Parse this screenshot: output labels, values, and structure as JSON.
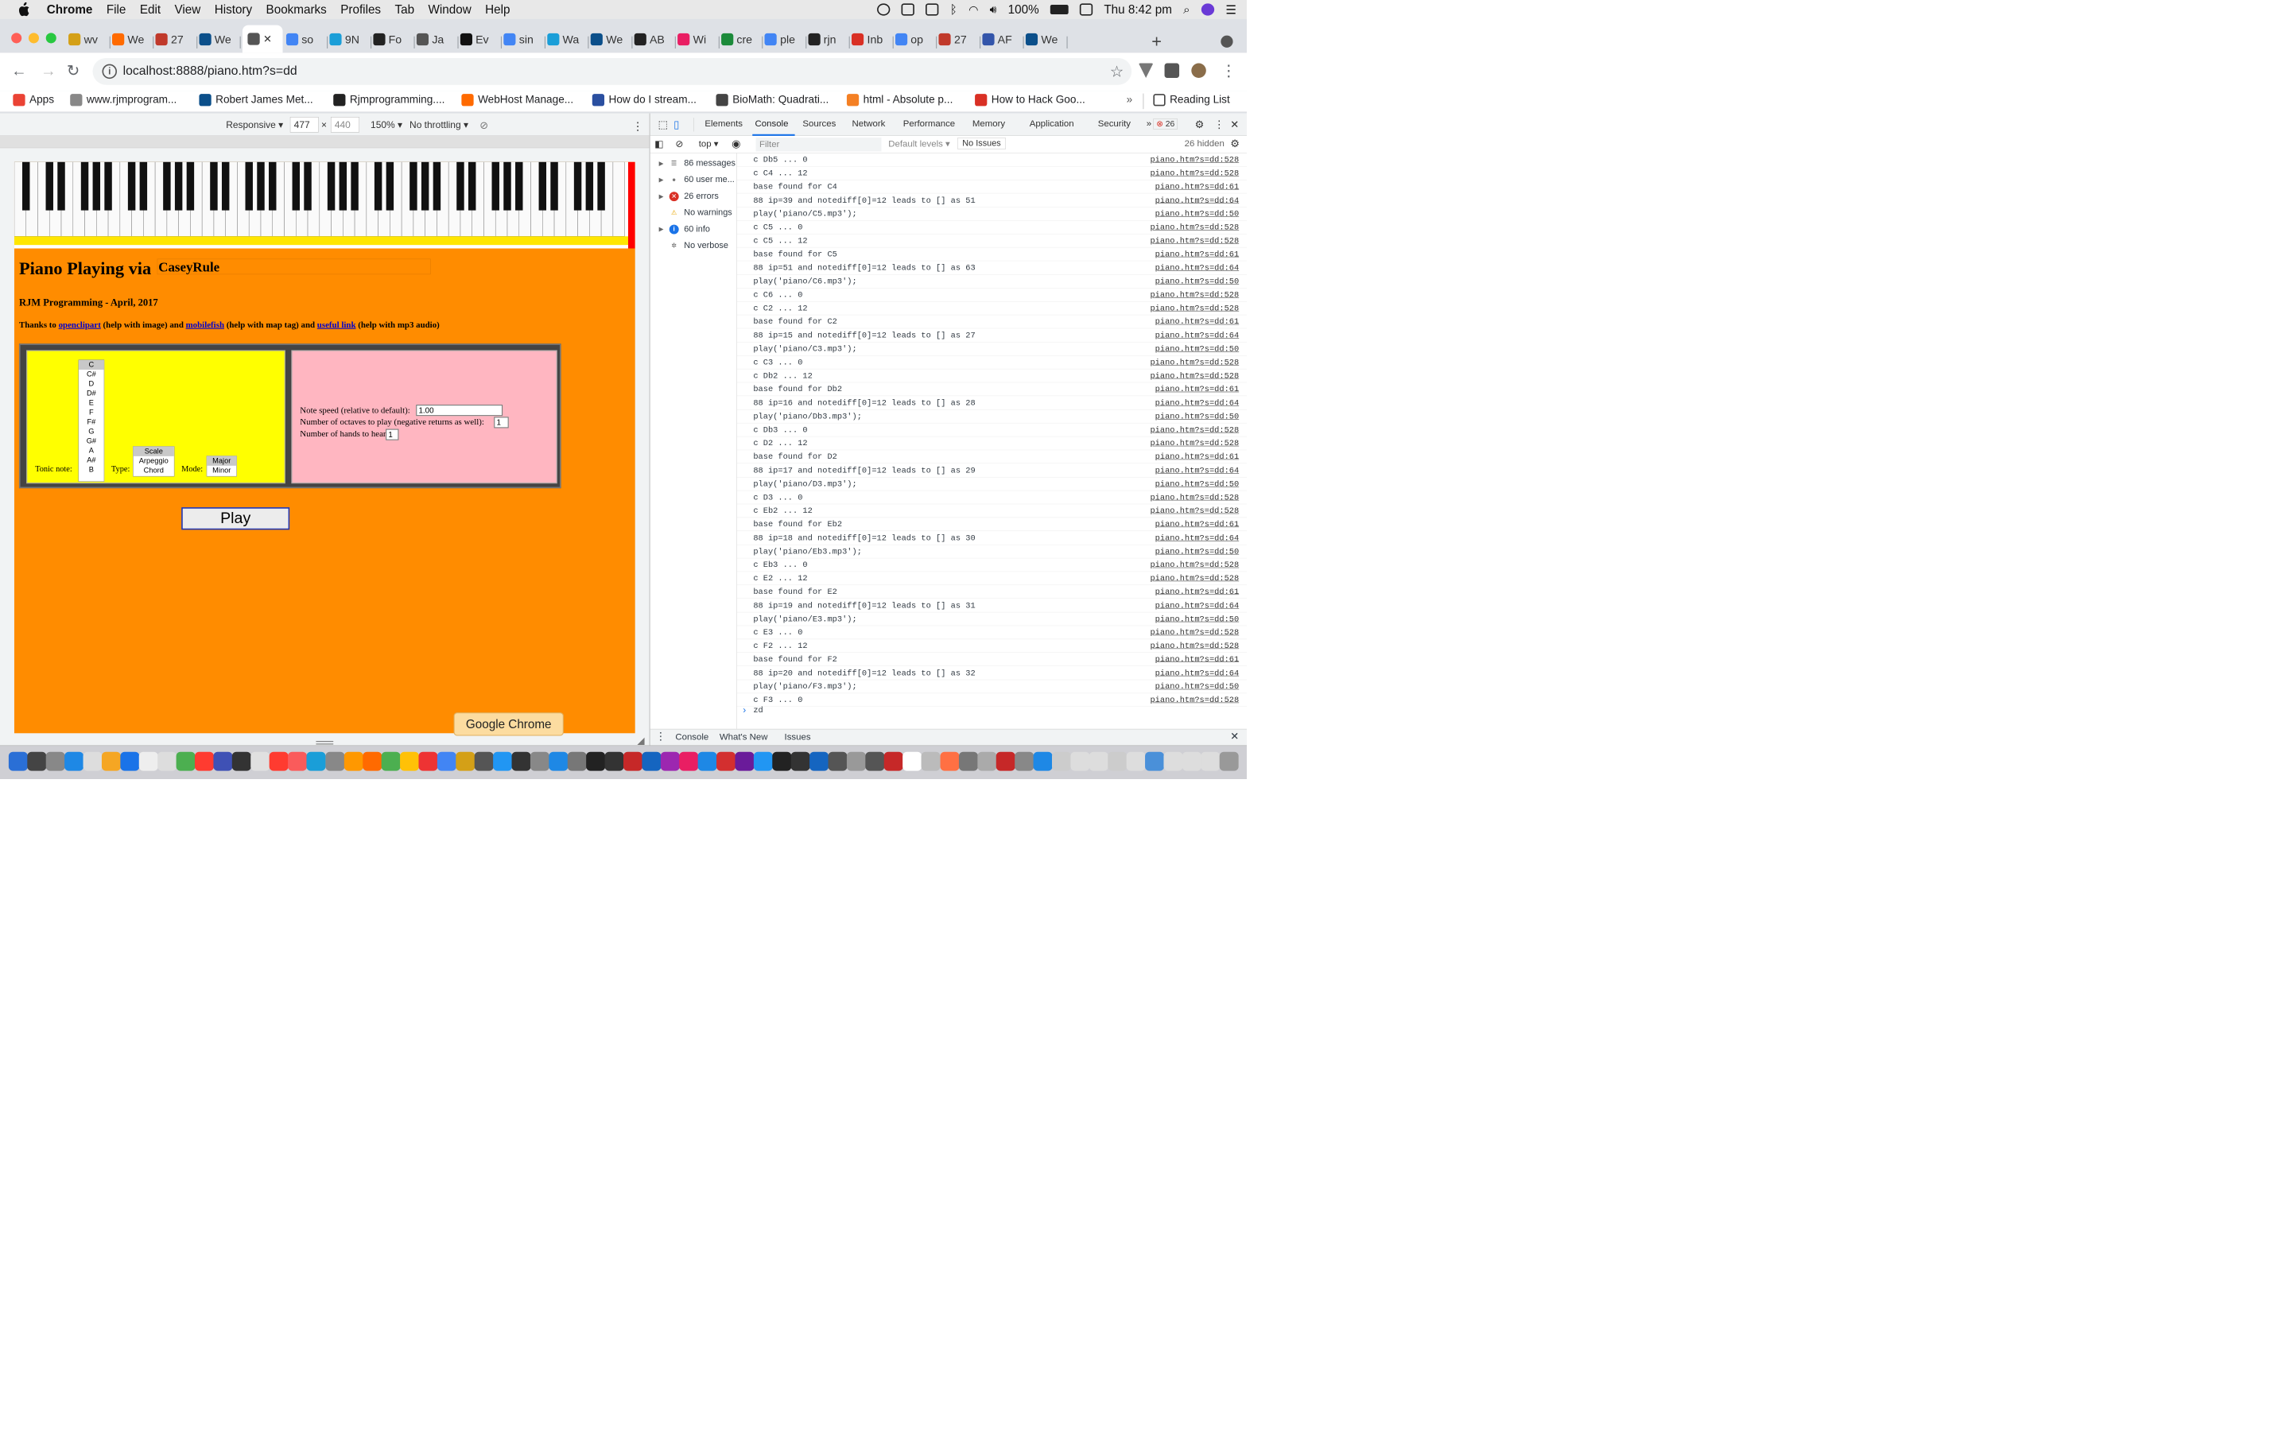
{
  "menubar": {
    "app": "Chrome",
    "items": [
      "File",
      "Edit",
      "View",
      "History",
      "Bookmarks",
      "Profiles",
      "Tab",
      "Window",
      "Help"
    ],
    "battery": "100%",
    "clock": "Thu 8:42 pm"
  },
  "tabs": [
    {
      "label": "wv",
      "color": "#d4a017"
    },
    {
      "label": "We",
      "color": "#ff6a00"
    },
    {
      "label": "27",
      "color": "#c0392b"
    },
    {
      "label": "We",
      "color": "#0b4f8a"
    },
    {
      "label": "",
      "color": "#555555",
      "active": true
    },
    {
      "label": "so",
      "color": "#4285f4"
    },
    {
      "label": "9N",
      "color": "#1a9ed8"
    },
    {
      "label": "Fo",
      "color": "#222222"
    },
    {
      "label": "Ja",
      "color": "#555555"
    },
    {
      "label": "Ev",
      "color": "#111111"
    },
    {
      "label": "sin",
      "color": "#4285f4"
    },
    {
      "label": "Wa",
      "color": "#1a9ed8"
    },
    {
      "label": "We",
      "color": "#0b4f8a"
    },
    {
      "label": "AB",
      "color": "#222222"
    },
    {
      "label": "Wi",
      "color": "#e91e63"
    },
    {
      "label": "cre",
      "color": "#1b8a3a"
    },
    {
      "label": "ple",
      "color": "#4285f4"
    },
    {
      "label": "rjn",
      "color": "#222222"
    },
    {
      "label": "Inb",
      "color": "#d93025"
    },
    {
      "label": "op",
      "color": "#4285f4"
    },
    {
      "label": "27",
      "color": "#c0392b"
    },
    {
      "label": "AF",
      "color": "#3355aa"
    },
    {
      "label": "We",
      "color": "#0b4f8a"
    }
  ],
  "toolbar": {
    "url": "localhost:8888/piano.htm?s=dd"
  },
  "bookmarks": [
    {
      "label": "Apps",
      "color": "#ea4335"
    },
    {
      "label": "www.rjmprogram...",
      "color": "#888888"
    },
    {
      "label": "Robert James Met...",
      "color": "#0b4f8a"
    },
    {
      "label": "Rjmprogramming....",
      "color": "#222222"
    },
    {
      "label": "WebHost Manage...",
      "color": "#ff6a00"
    },
    {
      "label": "How do I stream...",
      "color": "#2a4fa0"
    },
    {
      "label": "BioMath: Quadrati...",
      "color": "#444444"
    },
    {
      "label": "html - Absolute p...",
      "color": "#f48024"
    },
    {
      "label": "How to Hack Goo...",
      "color": "#d93025"
    }
  ],
  "reading_list": "Reading List",
  "devbar": {
    "mode": "Responsive",
    "width": "477",
    "x": "×",
    "height": "440",
    "zoom": "150%",
    "throttle": "No throttling"
  },
  "piano_page": {
    "title": "Piano Playing via",
    "casey": "CaseyRule",
    "subtitle": "RJM Programming - April, 2017",
    "thanks": {
      "t1": "Thanks to ",
      "l1": "openclipart",
      "t2": " (help with image) and ",
      "l2": "mobilefish",
      "t3": " (help with map tag) and ",
      "l3": "useful link",
      "t4": " (help with mp3 audio)"
    },
    "tonic_label": "Tonic note:",
    "notes": [
      "C",
      "C#",
      "D",
      "D#",
      "E",
      "F",
      "F#",
      "G",
      "G#",
      "A",
      "A#",
      "B"
    ],
    "type_label": "Type:",
    "types": [
      "Scale",
      "Arpeggio",
      "Chord"
    ],
    "mode_label": "Mode:",
    "modes": [
      "Major",
      "Minor"
    ],
    "speed_label": "Note speed (relative to default):",
    "speed_value": "1.00",
    "octaves_label": "Number of octaves to play (negative returns as well):",
    "octaves_value": "1",
    "hands_label": "Number of hands to hear:",
    "hands_value": "1",
    "play": "Play"
  },
  "tooltip": "Google Chrome",
  "devtools": {
    "tabs": [
      "Elements",
      "Console",
      "Sources",
      "Network",
      "Performance",
      "Memory",
      "Application",
      "Security"
    ],
    "more": "»",
    "error_count": "26",
    "context": "top",
    "filter_placeholder": "Filter",
    "levels": "Default levels",
    "no_issues": "No Issues",
    "hidden": "26 hidden",
    "sidebar": [
      {
        "label": "86 messages",
        "icon": "list"
      },
      {
        "label": "60 user me...",
        "icon": "user"
      },
      {
        "label": "26 errors",
        "icon": "error"
      },
      {
        "label": "No warnings",
        "icon": "warning"
      },
      {
        "label": "60 info",
        "icon": "info"
      },
      {
        "label": "No verbose",
        "icon": "verbose"
      }
    ],
    "log": [
      {
        "msg": "c Db5 ... 0",
        "src": "piano.htm?s=dd:528"
      },
      {
        "msg": "c C4 ... 12",
        "src": "piano.htm?s=dd:528"
      },
      {
        "msg": "base found for C4",
        "src": "piano.htm?s=dd:61"
      },
      {
        "msg": "88 ip=39 and notediff[0]=12 leads to [] as 51",
        "src": "piano.htm?s=dd:64"
      },
      {
        "msg": "play('piano/C5.mp3');",
        "src": "piano.htm?s=dd:50"
      },
      {
        "msg": "c C5 ... 0",
        "src": "piano.htm?s=dd:528"
      },
      {
        "msg": "c C5 ... 12",
        "src": "piano.htm?s=dd:528"
      },
      {
        "msg": "base found for C5",
        "src": "piano.htm?s=dd:61"
      },
      {
        "msg": "88 ip=51 and notediff[0]=12 leads to [] as 63",
        "src": "piano.htm?s=dd:64"
      },
      {
        "msg": "play('piano/C6.mp3');",
        "src": "piano.htm?s=dd:50"
      },
      {
        "msg": "c C6 ... 0",
        "src": "piano.htm?s=dd:528"
      },
      {
        "msg": "c C2 ... 12",
        "src": "piano.htm?s=dd:528"
      },
      {
        "msg": "base found for C2",
        "src": "piano.htm?s=dd:61"
      },
      {
        "msg": "88 ip=15 and notediff[0]=12 leads to [] as 27",
        "src": "piano.htm?s=dd:64"
      },
      {
        "msg": "play('piano/C3.mp3');",
        "src": "piano.htm?s=dd:50"
      },
      {
        "msg": "c C3 ... 0",
        "src": "piano.htm?s=dd:528"
      },
      {
        "msg": "c Db2 ... 12",
        "src": "piano.htm?s=dd:528"
      },
      {
        "msg": "base found for Db2",
        "src": "piano.htm?s=dd:61"
      },
      {
        "msg": "88 ip=16 and notediff[0]=12 leads to [] as 28",
        "src": "piano.htm?s=dd:64"
      },
      {
        "msg": "play('piano/Db3.mp3');",
        "src": "piano.htm?s=dd:50"
      },
      {
        "msg": "c Db3 ... 0",
        "src": "piano.htm?s=dd:528"
      },
      {
        "msg": "c D2 ... 12",
        "src": "piano.htm?s=dd:528"
      },
      {
        "msg": "base found for D2",
        "src": "piano.htm?s=dd:61"
      },
      {
        "msg": "88 ip=17 and notediff[0]=12 leads to [] as 29",
        "src": "piano.htm?s=dd:64"
      },
      {
        "msg": "play('piano/D3.mp3');",
        "src": "piano.htm?s=dd:50"
      },
      {
        "msg": "c D3 ... 0",
        "src": "piano.htm?s=dd:528"
      },
      {
        "msg": "c Eb2 ... 12",
        "src": "piano.htm?s=dd:528"
      },
      {
        "msg": "base found for Eb2",
        "src": "piano.htm?s=dd:61"
      },
      {
        "msg": "88 ip=18 and notediff[0]=12 leads to [] as 30",
        "src": "piano.htm?s=dd:64"
      },
      {
        "msg": "play('piano/Eb3.mp3');",
        "src": "piano.htm?s=dd:50"
      },
      {
        "msg": "c Eb3 ... 0",
        "src": "piano.htm?s=dd:528"
      },
      {
        "msg": "c E2 ... 12",
        "src": "piano.htm?s=dd:528"
      },
      {
        "msg": "base found for E2",
        "src": "piano.htm?s=dd:61"
      },
      {
        "msg": "88 ip=19 and notediff[0]=12 leads to [] as 31",
        "src": "piano.htm?s=dd:64"
      },
      {
        "msg": "play('piano/E3.mp3');",
        "src": "piano.htm?s=dd:50"
      },
      {
        "msg": "c E3 ... 0",
        "src": "piano.htm?s=dd:528"
      },
      {
        "msg": "c F2 ... 12",
        "src": "piano.htm?s=dd:528"
      },
      {
        "msg": "base found for F2",
        "src": "piano.htm?s=dd:61"
      },
      {
        "msg": "88 ip=20 and notediff[0]=12 leads to [] as 32",
        "src": "piano.htm?s=dd:64"
      },
      {
        "msg": "play('piano/F3.mp3');",
        "src": "piano.htm?s=dd:50"
      },
      {
        "msg": "c F3 ... 0",
        "src": "piano.htm?s=dd:528"
      }
    ],
    "prompt": "zd",
    "drawer": [
      "Console",
      "What's New",
      "Issues"
    ]
  },
  "dock_colors": [
    "#2a6fd6",
    "#444",
    "#888",
    "#1e88e5",
    "#ddd",
    "#f5a623",
    "#1a73e8",
    "#eee",
    "#ddd",
    "#4caf50",
    "#ff3b30",
    "#3f51b5",
    "#333",
    "#e0e0e0",
    "#ff3b30",
    "#fa5b5b",
    "#1a9ed8",
    "#888",
    "#ff9800",
    "#ff6a00",
    "#4caf50",
    "#ffc107",
    "#e33",
    "#4285f4",
    "#d4a017",
    "#555",
    "#2196f3",
    "#333",
    "#888",
    "#1e88e5",
    "#777",
    "#222",
    "#333",
    "#c62828",
    "#1565c0",
    "#9c27b0",
    "#e91e63",
    "#1e88e5",
    "#d32f2f",
    "#6a1b9a",
    "#2196f3",
    "#222",
    "#333",
    "#1565c0",
    "#555",
    "#999",
    "#555",
    "#c62828",
    "#fff",
    "#bbb",
    "#ff7043",
    "#777",
    "#aaa",
    "#c62828",
    "#888",
    "#1e88e5",
    "#ccc",
    "#ddd",
    "#ddd",
    "#ccc",
    "#ddd",
    "#4a90d9",
    "#ddd",
    "#ddd",
    "#ddd",
    "#999"
  ]
}
